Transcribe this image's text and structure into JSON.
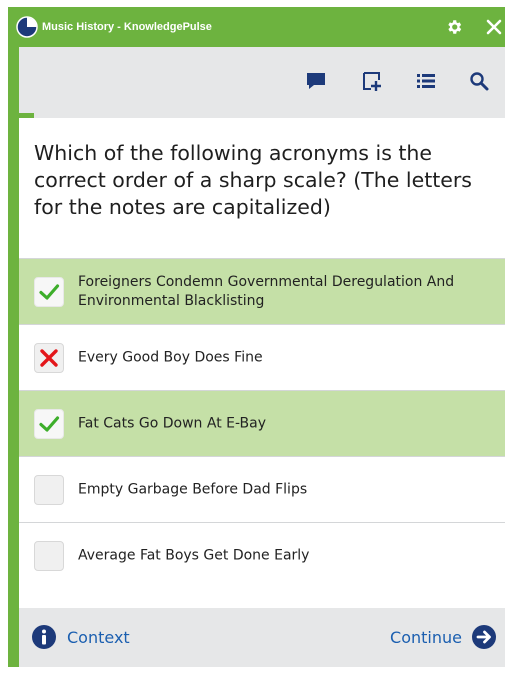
{
  "window": {
    "title": "Music History - KnowledgePulse"
  },
  "toolbar": {
    "icons": [
      "comment-icon",
      "add-note-icon",
      "list-icon",
      "search-icon"
    ]
  },
  "progress": {
    "fraction": 0.03
  },
  "question": {
    "text": "Which of the following acronyms is the correct order of a sharp scale? (The letters for the notes are capitalized)"
  },
  "answers": [
    {
      "label": "Foreigners Condemn Governmental Deregulation And Environmental Blacklisting",
      "state": "correct",
      "selected": true
    },
    {
      "label": "Every Good Boy Does Fine",
      "state": "wrong",
      "selected": false
    },
    {
      "label": "Fat Cats Go Down At E-Bay",
      "state": "correct",
      "selected": true
    },
    {
      "label": "Empty Garbage Before Dad Flips",
      "state": "empty",
      "selected": false
    },
    {
      "label": "Average Fat Boys Get Done Early",
      "state": "empty",
      "selected": false
    }
  ],
  "footer": {
    "context_label": "Context",
    "continue_label": "Continue"
  },
  "colors": {
    "brand_green": "#6db33f",
    "selected_row": "#c5e0a7",
    "link_blue": "#1b5fb0",
    "icon_navy": "#1d3a7a",
    "wrong_red": "#e3161a",
    "check_green": "#3dae2b"
  }
}
